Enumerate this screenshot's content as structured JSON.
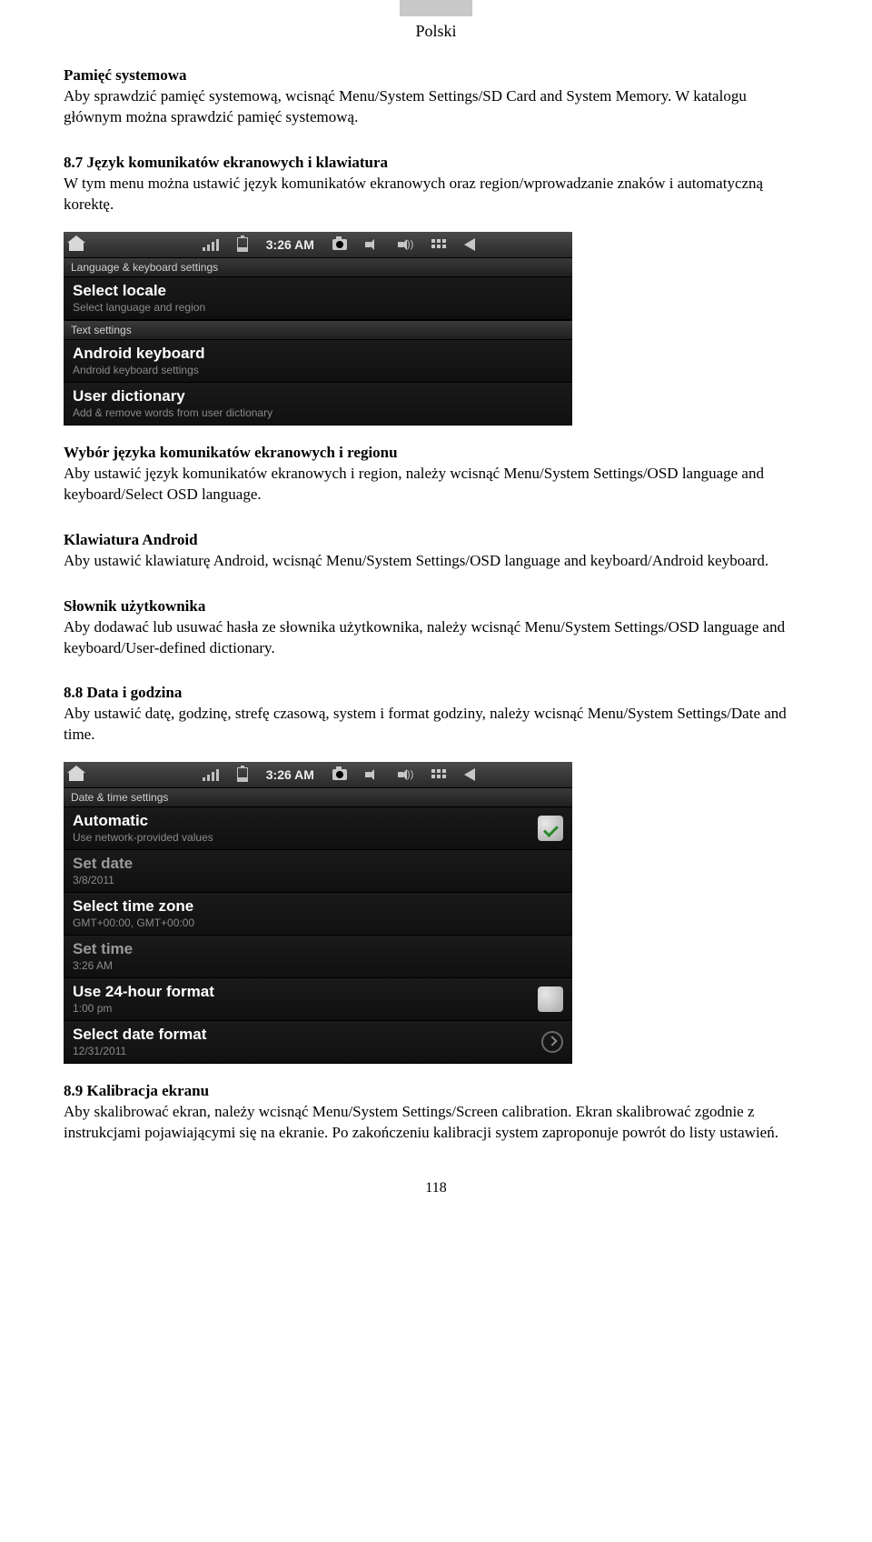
{
  "header": {
    "label": "Polski"
  },
  "sec1": {
    "title": "Pamięć systemowa",
    "body": "Aby sprawdzić pamięć systemową, wcisnąć Menu/System Settings/SD Card and System Memory. W katalogu głównym można sprawdzić pamięć systemową."
  },
  "sec2": {
    "title": "8.7 Język komunikatów ekranowych i klawiatura",
    "body": "W tym menu można ustawić język komunikatów ekranowych oraz region/wprowadzanie znaków i automatyczną korektę."
  },
  "shot1": {
    "time": "3:26 AM",
    "header": "Language & keyboard settings",
    "row1": {
      "title": "Select locale",
      "sub": "Select language and region"
    },
    "subheader2": "Text settings",
    "row2": {
      "title": "Android keyboard",
      "sub": "Android keyboard settings"
    },
    "row3": {
      "title": "User dictionary",
      "sub": "Add & remove words from user dictionary"
    }
  },
  "sec3": {
    "title": "Wybór języka komunikatów ekranowych i regionu",
    "body": "Aby ustawić język komunikatów ekranowych i region, należy wcisnąć Menu/System Settings/OSD language and keyboard/Select OSD language."
  },
  "sec4": {
    "title": "Klawiatura Android",
    "body": "Aby ustawić klawiaturę Android, wcisnąć Menu/System Settings/OSD language and keyboard/Android keyboard."
  },
  "sec5": {
    "title": "Słownik użytkownika",
    "body": "Aby dodawać lub usuwać hasła ze słownika użytkownika, należy wcisnąć Menu/System Settings/OSD language and keyboard/User-defined dictionary."
  },
  "sec6": {
    "title": "8.8 Data i godzina",
    "body": "Aby ustawić datę, godzinę, strefę czasową, system i format godziny, należy wcisnąć Menu/System Settings/Date and time."
  },
  "shot2": {
    "time": "3:26 AM",
    "header": "Date & time settings",
    "row1": {
      "title": "Automatic",
      "sub": "Use network-provided values"
    },
    "row2": {
      "title": "Set date",
      "sub": "3/8/2011"
    },
    "row3": {
      "title": "Select time zone",
      "sub": "GMT+00:00, GMT+00:00"
    },
    "row4": {
      "title": "Set time",
      "sub": "3:26 AM"
    },
    "row5": {
      "title": "Use 24-hour format",
      "sub": "1:00 pm"
    },
    "row6": {
      "title": "Select date format",
      "sub": "12/31/2011"
    }
  },
  "sec7": {
    "title": "8.9 Kalibracja ekranu",
    "body": "Aby skalibrować ekran, należy wcisnąć Menu/System Settings/Screen calibration. Ekran skalibrować zgodnie z instrukcjami pojawiającymi się na ekranie. Po zakończeniu kalibracji system zaproponuje powrót do listy ustawień."
  },
  "page_number": "118"
}
